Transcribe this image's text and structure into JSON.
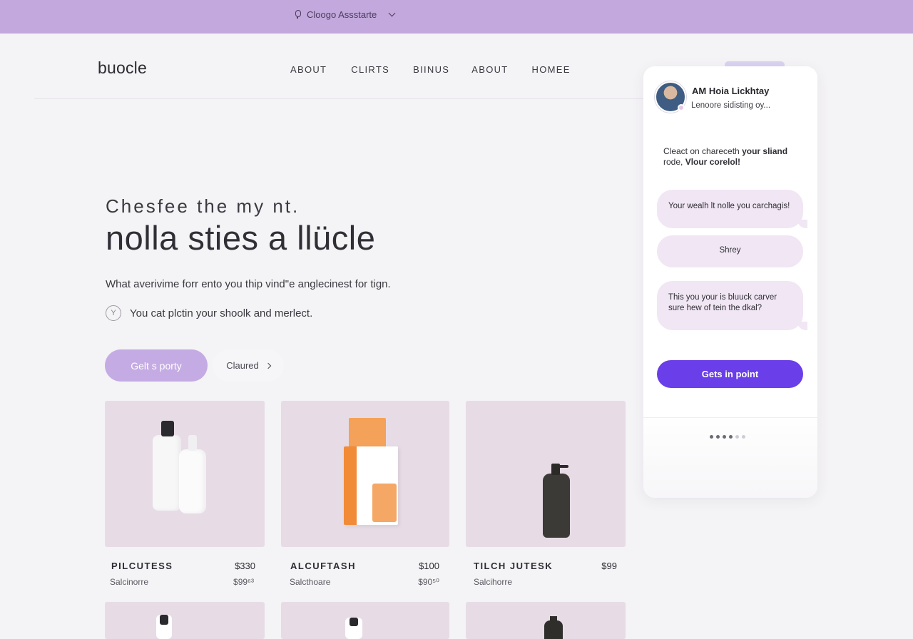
{
  "topbar": {
    "assistant_label": "Cloogo Assstarte"
  },
  "header": {
    "logo": "buocle",
    "nav": [
      "ABOUT",
      "CLIRTS",
      "BIINUS",
      "ABOUT",
      "HOMEE"
    ]
  },
  "hero": {
    "kicker": "Chesfee the my  nt.",
    "title": "nolla sties a llücle",
    "subtitle": "What averivime forr ento you thip vind\"e anglecinest for tign.",
    "check_text": "You cat plctin your shoolk and merlect.",
    "check_icon_glyph": "Y",
    "primary_button": "Gelt s porty",
    "secondary_button": "Claured"
  },
  "products": [
    {
      "name": "PILCUTESS",
      "price": "$330",
      "brand": "Salcinorre",
      "old_price": "$99⁶³"
    },
    {
      "name": "ALCUFTASH",
      "price": "$100",
      "brand": "Salcthoare",
      "old_price": "$90⁵⁰"
    },
    {
      "name": "TILCH JUTESK",
      "price": "$99",
      "brand": "Salcihorre",
      "old_price": ""
    }
  ],
  "chat": {
    "name": "AM Hoia Lickhtay",
    "status": "Lenoore sidisting oy...",
    "intro_plain": "Cleact on chareceth ",
    "intro_bold1": "your sliand",
    "intro_plain2": " rode, ",
    "intro_bold2": "Vlour corelol!",
    "bubble1": "Your wealh lt nolle you carchagis!",
    "bubble2": "Shrey",
    "bubble3": "This you your is bluuck carver sure hew of tein the dkal?",
    "cta": "Gets in point",
    "pager_dots": 6,
    "pager_active": 3
  },
  "colors": {
    "topbar": "#c2a8dc",
    "primary_button": "#c5abe3",
    "chat_cta": "#6a3ee8",
    "card_bg": "#e7dce6",
    "bubble_bg": "#f1e6f4"
  }
}
